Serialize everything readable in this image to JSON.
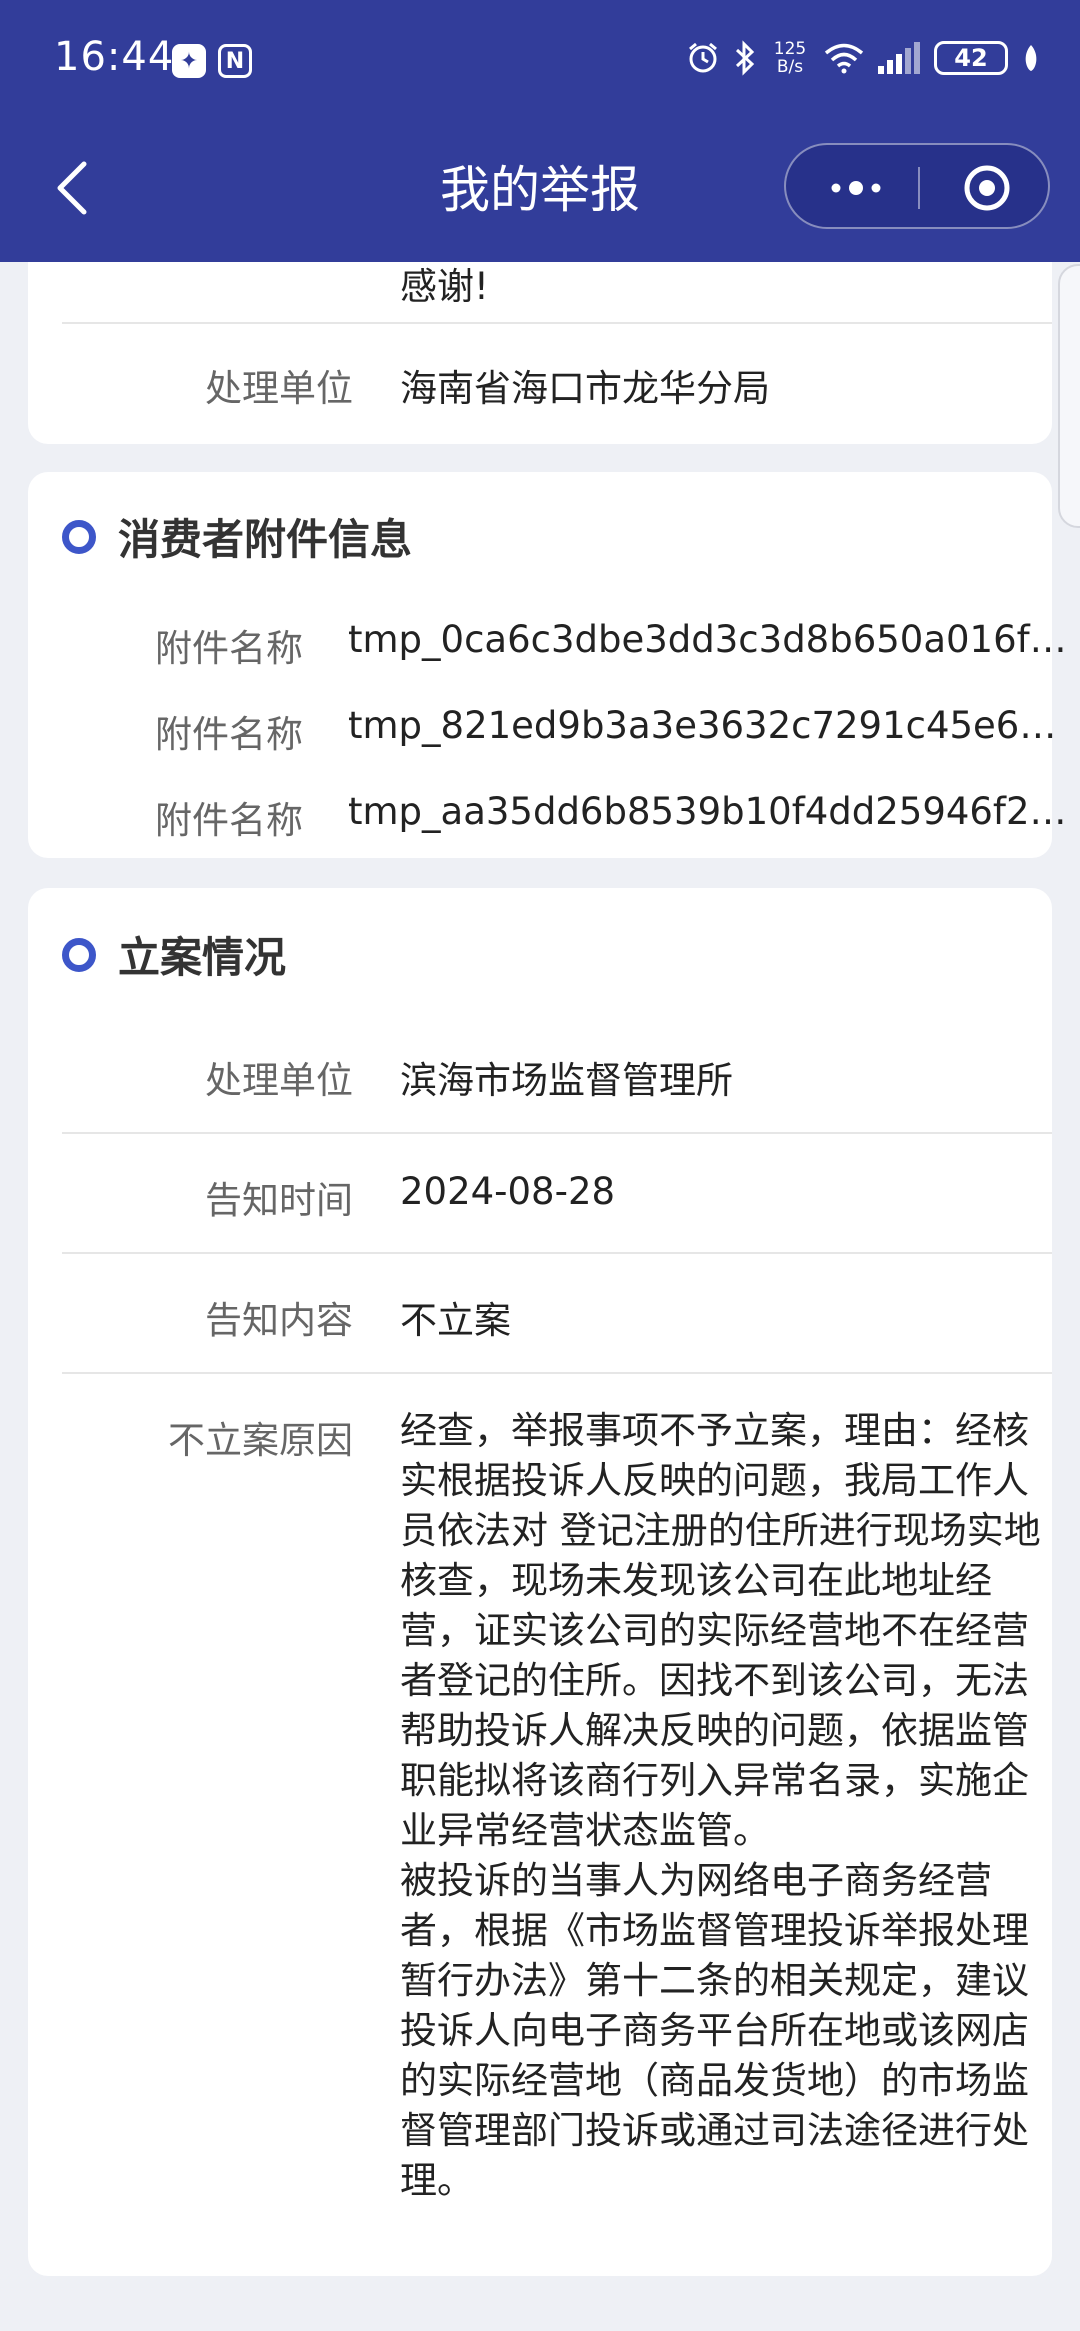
{
  "status_bar": {
    "time": "16:44",
    "net_speed_value": "125",
    "net_speed_unit": "B/s",
    "battery": "42"
  },
  "nav": {
    "title": "我的举报"
  },
  "top_card": {
    "partial_text": "感谢!",
    "label": "处理单位",
    "value": "海南省海口市龙华分局"
  },
  "attachments": {
    "title": "消费者附件信息",
    "items": [
      {
        "label": "附件名称",
        "value": "tmp_0ca6c3dbe3dd3c3d8b650a016f…"
      },
      {
        "label": "附件名称",
        "value": "tmp_821ed9b3a3e3632c7291c45e6a…"
      },
      {
        "label": "附件名称",
        "value": "tmp_aa35dd6b8539b10f4dd25946f2…"
      }
    ]
  },
  "filing": {
    "title": "立案情况",
    "rows": [
      {
        "label": "处理单位",
        "value": "滨海市场监督管理所"
      },
      {
        "label": "告知时间",
        "value": "2024-08-28"
      },
      {
        "label": "告知内容",
        "value": "不立案"
      }
    ],
    "reason_label": "不立案原因",
    "reason_text": "经查，举报事项不予立案，理由：经核实根据投诉人反映的问题，我局工作人员依法对 登记注册的住所进行现场实地核查，现场未发现该公司在此地址经营，证实该公司的实际经营地不在经营者登记的住所。因找不到该公司，无法帮助投诉人解决反映的问题，依据监管职能拟将该商行列入异常名录，实施企业异常经营状态监管。\n被投诉的当事人为网络电子商务经营者，根据《市场监督管理投诉举报处理暂行办法》第十二条的相关规定，建议投诉人向电子商务平台所在地或该网店的实际经营地（商品发货地）的市场监督管理部门投诉或通过司法途径进行处理。"
  },
  "colors": {
    "header_bg": "#323d9a",
    "accent": "#3d56c9",
    "page_bg": "#eef0f5"
  }
}
